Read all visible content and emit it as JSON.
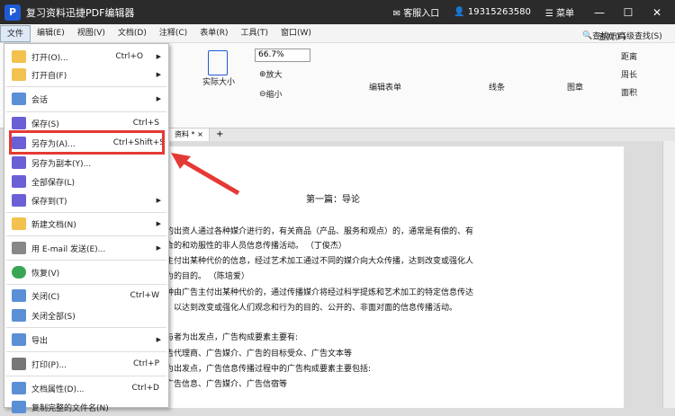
{
  "titlebar": {
    "app_title": "复习资料迅捷PDF编辑器",
    "service": "客服入口",
    "phone": "19315263580",
    "menu": "菜单",
    "min": "—",
    "max": "☐",
    "close": "✕"
  },
  "menubar": [
    "文件",
    "编辑(E)",
    "视图(V)",
    "文档(D)",
    "注释(C)",
    "表单(R)",
    "工具(T)",
    "窗口(W)"
  ],
  "ribbon": {
    "actual_size": "实际大小",
    "zoom_value": "66.7%",
    "zoom_in": "放大",
    "zoom_out": "缩小",
    "edit_form": "编辑表单",
    "line": "线条",
    "stamp": "图章",
    "find": "查找(F)",
    "advanced_find": "高级查找(S)",
    "distance": "距离",
    "perimeter": "周长",
    "area": "面积"
  },
  "tab": {
    "label": "资料 *",
    "close": "×",
    "add": "+"
  },
  "file_menu": [
    {
      "label": "打开(O)...",
      "shortcut": "Ctrl+O",
      "arrow": "▶",
      "icon": "open-folder-icon"
    },
    {
      "label": "打开自(F)",
      "shortcut": "",
      "arrow": "▶",
      "icon": "open-from-icon"
    },
    {
      "label": "会话",
      "shortcut": "",
      "arrow": "▶",
      "icon": "session-icon"
    },
    {
      "label": "保存(S)",
      "shortcut": "Ctrl+S",
      "arrow": "",
      "icon": "save-icon"
    },
    {
      "label": "另存为(A)...",
      "shortcut": "Ctrl+Shift+S",
      "arrow": "",
      "icon": "save-as-icon"
    },
    {
      "label": "另存为副本(Y)...",
      "shortcut": "",
      "arrow": "",
      "icon": "save-copy-icon"
    },
    {
      "label": "全部保存(L)",
      "shortcut": "",
      "arrow": "",
      "icon": "save-all-icon"
    },
    {
      "label": "保存到(T)",
      "shortcut": "",
      "arrow": "▶",
      "icon": "save-to-icon"
    },
    {
      "label": "新建文档(N)",
      "shortcut": "",
      "arrow": "▶",
      "icon": "new-document-icon"
    },
    {
      "label": "用 E-mail 发送(E)...",
      "shortcut": "",
      "arrow": "▶",
      "icon": "email-icon"
    },
    {
      "label": "恢复(V)",
      "shortcut": "",
      "arrow": "",
      "icon": "restore-icon"
    },
    {
      "label": "关闭(C)",
      "shortcut": "Ctrl+W",
      "arrow": "",
      "icon": "close-doc-icon"
    },
    {
      "label": "关闭全部(S)",
      "shortcut": "",
      "arrow": "",
      "icon": "close-all-icon"
    },
    {
      "label": "导出",
      "shortcut": "",
      "arrow": "▶",
      "icon": "export-icon"
    },
    {
      "label": "打印(P)...",
      "shortcut": "Ctrl+P",
      "arrow": "",
      "icon": "print-icon"
    },
    {
      "label": "文档属性(D)...",
      "shortcut": "Ctrl+D",
      "arrow": "",
      "icon": "properties-icon"
    },
    {
      "label": "复制完整的文件名(N)",
      "shortcut": "",
      "arrow": "",
      "icon": "copy-filename-icon"
    }
  ],
  "document": {
    "title": "第一篇：导论",
    "lines": [
      "的出资人通过各种媒介进行的，有关商品（产品、服务和观点）的，通常是有偿的、有",
      "合的和劝服性的非人员信息传播活动。                              （丁俊杰）",
      "主付出某种代价的信息，经过艺术加工通过不同的媒介向大众传播，达到改变或强化人",
      "为的目的。                                                              （陈培爱）",
      "种由广告主付出某种代价的，通过传播媒介将经过科学提炼和艺术加工的特定信息传达",
      "，以达到改变或强化人们观念和行为的目的、公开的、非面对面的信息传播活动。",
      "",
      "与者为出发点，广告构成要素主要有:",
      "告代理商、广告媒介、广告的目标受众、广告文本等",
      "为出发点，广告信息传播过程中的广告构成要素主要包括:",
      "广告信息、广告媒介、广告信宿等"
    ]
  },
  "colors": {
    "accent": "#1f5bd6",
    "highlight": "#e53935"
  }
}
